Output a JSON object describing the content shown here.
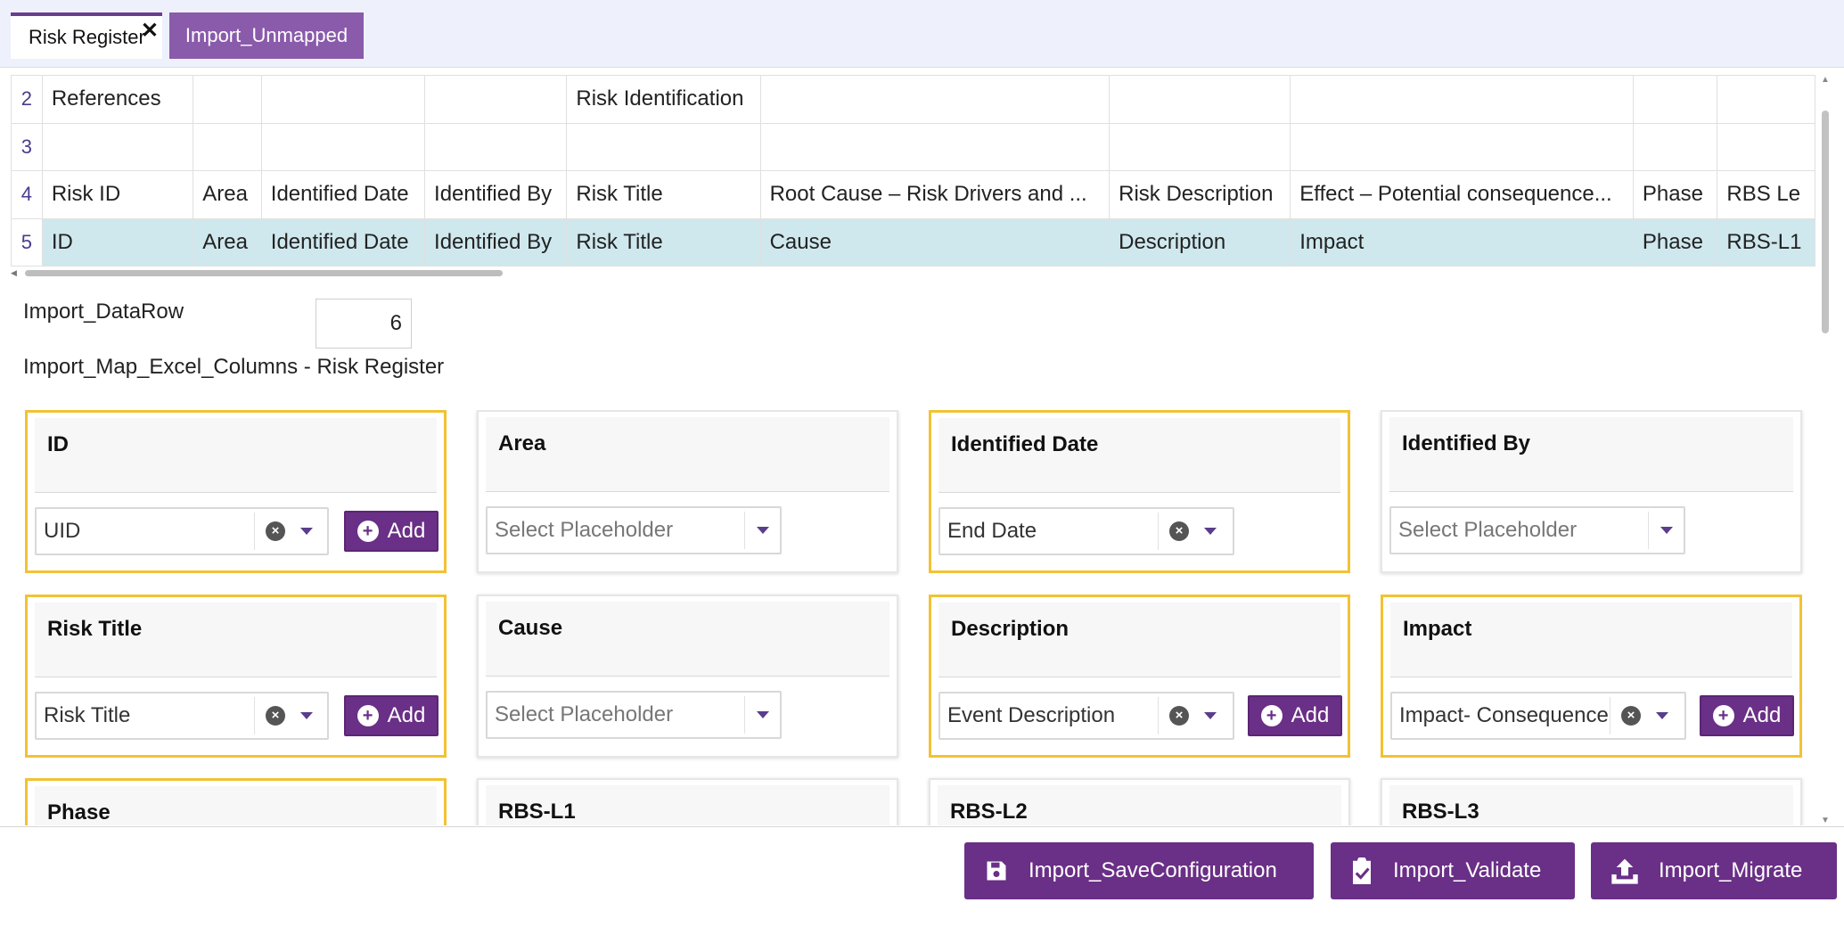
{
  "tabs": [
    {
      "label": "Risk Register",
      "active": true
    },
    {
      "label": "Import_Unmapped",
      "active": false
    }
  ],
  "sheet": {
    "rows": [
      {
        "num": "2",
        "cells": [
          "References",
          "",
          "",
          "",
          "Risk Identification",
          "",
          "",
          "",
          "",
          ""
        ]
      },
      {
        "num": "3",
        "cells": [
          "",
          "",
          "",
          "",
          "",
          "",
          "",
          "",
          "",
          ""
        ]
      },
      {
        "num": "4",
        "cells": [
          "Risk ID",
          "Area",
          "Identified Date",
          "Identified By",
          "Risk Title",
          "Root Cause – Risk Drivers and ...",
          "Risk Description",
          "Effect – Potential consequence...",
          "Phase",
          "RBS Le"
        ]
      },
      {
        "num": "5",
        "cells": [
          "ID",
          "Area",
          "Identified Date",
          "Identified By",
          "Risk Title",
          "Cause",
          "Description",
          "Impact",
          "Phase",
          "RBS-L1"
        ]
      }
    ]
  },
  "import": {
    "data_row_label": "Import_DataRow",
    "data_row_value": "6",
    "map_title": "Import_Map_Excel_Columns - Risk Register"
  },
  "cards": [
    {
      "title": "ID",
      "value": "UID",
      "placeholder": false,
      "mapped": true,
      "add_label": "Add"
    },
    {
      "title": "Area",
      "value": "Select Placeholder",
      "placeholder": true,
      "mapped": false
    },
    {
      "title": "Identified Date",
      "value": "End Date",
      "placeholder": false,
      "mapped": true
    },
    {
      "title": "Identified By",
      "value": "Select Placeholder",
      "placeholder": true,
      "mapped": false
    },
    {
      "title": "Risk Title",
      "value": "Risk Title",
      "placeholder": false,
      "mapped": true,
      "add_label": "Add"
    },
    {
      "title": "Cause",
      "value": "Select Placeholder",
      "placeholder": true,
      "mapped": false
    },
    {
      "title": "Description",
      "value": "Event Description",
      "placeholder": false,
      "mapped": true,
      "add_label": "Add"
    },
    {
      "title": "Impact",
      "value": "Impact- Consequence",
      "placeholder": false,
      "mapped": true,
      "add_label": "Add"
    },
    {
      "title": "Phase",
      "mapped": true
    },
    {
      "title": "RBS-L1",
      "mapped": false
    },
    {
      "title": "RBS-L2",
      "mapped": false
    },
    {
      "title": "RBS-L3",
      "mapped": false
    }
  ],
  "actions": {
    "save": "Import_SaveConfiguration",
    "validate": "Import_Validate",
    "migrate": "Import_Migrate"
  },
  "colors": {
    "accent": "#6a2f86",
    "mapped_border": "#f2c233",
    "highlight_row": "#cfe8ee"
  }
}
